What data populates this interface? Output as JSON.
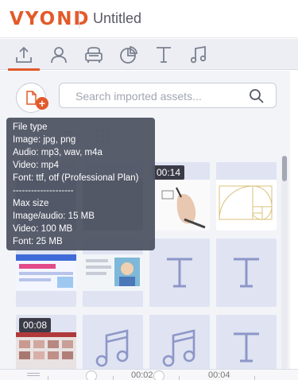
{
  "header": {
    "logo": "VYOND",
    "project_title": "Untitled"
  },
  "tabs": [
    {
      "name": "upload-icon",
      "active": true
    },
    {
      "name": "user-icon",
      "active": false
    },
    {
      "name": "armchair-icon",
      "active": false
    },
    {
      "name": "pie-chart-icon",
      "active": false
    },
    {
      "name": "text-icon",
      "active": false
    },
    {
      "name": "music-icon",
      "active": false
    }
  ],
  "search": {
    "placeholder": "Search imported assets..."
  },
  "tooltip": {
    "lines": [
      "File type",
      "Image: jpg, png",
      "Audio: mp3, wav, m4a",
      "Video: mp4",
      "Font: ttf, otf (Professional Plan)",
      "--------------------",
      "Max size",
      "Image/audio: 15 MB",
      "Video: 100 MB",
      "Font: 25 MB"
    ]
  },
  "assets": [
    {
      "kind": "video",
      "duration": ""
    },
    {
      "kind": "video",
      "duration": ""
    },
    {
      "kind": "video",
      "duration": "00:14"
    },
    {
      "kind": "image",
      "duration": ""
    },
    {
      "kind": "image",
      "duration": ""
    },
    {
      "kind": "image",
      "duration": ""
    },
    {
      "kind": "font",
      "duration": ""
    },
    {
      "kind": "font",
      "duration": ""
    },
    {
      "kind": "video",
      "duration": "00:08"
    },
    {
      "kind": "audio",
      "duration": ""
    },
    {
      "kind": "audio",
      "duration": ""
    },
    {
      "kind": "font",
      "duration": ""
    }
  ],
  "timeline": {
    "marks": [
      "00:02",
      "00:04"
    ]
  },
  "colors": {
    "accent": "#e25a2a",
    "tile_bg": "#dfe3f2",
    "icon": "#8d97c8",
    "tooltip_bg": "#535867"
  }
}
